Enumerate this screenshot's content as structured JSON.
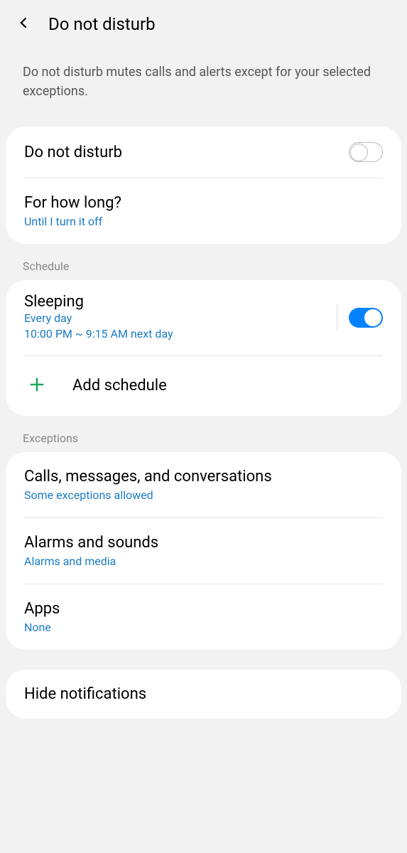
{
  "header": {
    "title": "Do not disturb"
  },
  "description": "Do not disturb mutes calls and alerts except for your selected exceptions.",
  "main_toggle": {
    "title": "Do not disturb",
    "enabled": false
  },
  "duration": {
    "title": "For how long?",
    "value": "Until I turn it off"
  },
  "schedule_header": "Schedule",
  "schedule": {
    "name": "Sleeping",
    "days": "Every day",
    "time": "10:00 PM ~ 9:15 AM next day",
    "enabled": true
  },
  "add_schedule": "Add schedule",
  "exceptions_header": "Exceptions",
  "exceptions": {
    "calls": {
      "title": "Calls, messages, and conversations",
      "subtitle": "Some exceptions allowed"
    },
    "alarms": {
      "title": "Alarms and sounds",
      "subtitle": "Alarms and media"
    },
    "apps": {
      "title": "Apps",
      "subtitle": "None"
    }
  },
  "hide_notifications": "Hide notifications"
}
